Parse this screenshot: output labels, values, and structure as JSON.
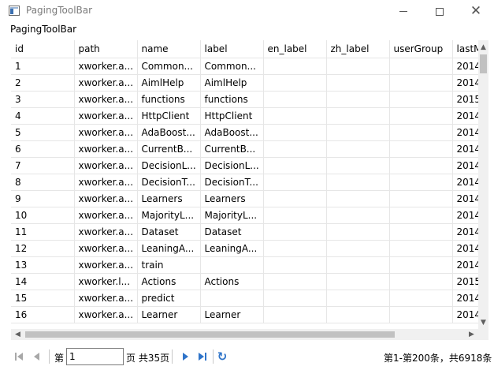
{
  "window": {
    "title": "PagingToolBar"
  },
  "panel": {
    "title": "PagingToolBar"
  },
  "grid": {
    "columns": [
      "id",
      "path",
      "name",
      "label",
      "en_label",
      "zh_label",
      "userGroup",
      "lastM"
    ],
    "rows": [
      [
        "1",
        "xworker.a...",
        "Common...",
        "Common...",
        "",
        "",
        "",
        "2014"
      ],
      [
        "2",
        "xworker.a...",
        "AimlHelp",
        "AimlHelp",
        "",
        "",
        "",
        "2014"
      ],
      [
        "3",
        "xworker.a...",
        "functions",
        "functions",
        "",
        "",
        "",
        "2015"
      ],
      [
        "4",
        "xworker.a...",
        "HttpClient",
        "HttpClient",
        "",
        "",
        "",
        "2014"
      ],
      [
        "5",
        "xworker.a...",
        "AdaBoost...",
        "AdaBoost...",
        "",
        "",
        "",
        "2014"
      ],
      [
        "6",
        "xworker.a...",
        "CurrentB...",
        "CurrentB...",
        "",
        "",
        "",
        "2014"
      ],
      [
        "7",
        "xworker.a...",
        "DecisionL...",
        "DecisionL...",
        "",
        "",
        "",
        "2014"
      ],
      [
        "8",
        "xworker.a...",
        "DecisionT...",
        "DecisionT...",
        "",
        "",
        "",
        "2014"
      ],
      [
        "9",
        "xworker.a...",
        "Learners",
        "Learners",
        "",
        "",
        "",
        "2014"
      ],
      [
        "10",
        "xworker.a...",
        "MajorityL...",
        "MajorityL...",
        "",
        "",
        "",
        "2014"
      ],
      [
        "11",
        "xworker.a...",
        "Dataset",
        "Dataset",
        "",
        "",
        "",
        "2014"
      ],
      [
        "12",
        "xworker.a...",
        "LeaningA...",
        "LeaningA...",
        "",
        "",
        "",
        "2014"
      ],
      [
        "13",
        "xworker.a...",
        "train",
        "",
        "",
        "",
        "",
        "2014"
      ],
      [
        "14",
        "xworker.l...",
        "Actions",
        "Actions",
        "",
        "",
        "",
        "2015"
      ],
      [
        "15",
        "xworker.a...",
        "predict",
        "",
        "",
        "",
        "",
        "2014"
      ],
      [
        "16",
        "xworker.a...",
        "Learner",
        "Learner",
        "",
        "",
        "",
        "2014"
      ]
    ]
  },
  "pager": {
    "page_prefix": "第",
    "page_value": "1",
    "page_suffix": "页 共35页",
    "summary": "第1-第200条，共6918条"
  }
}
